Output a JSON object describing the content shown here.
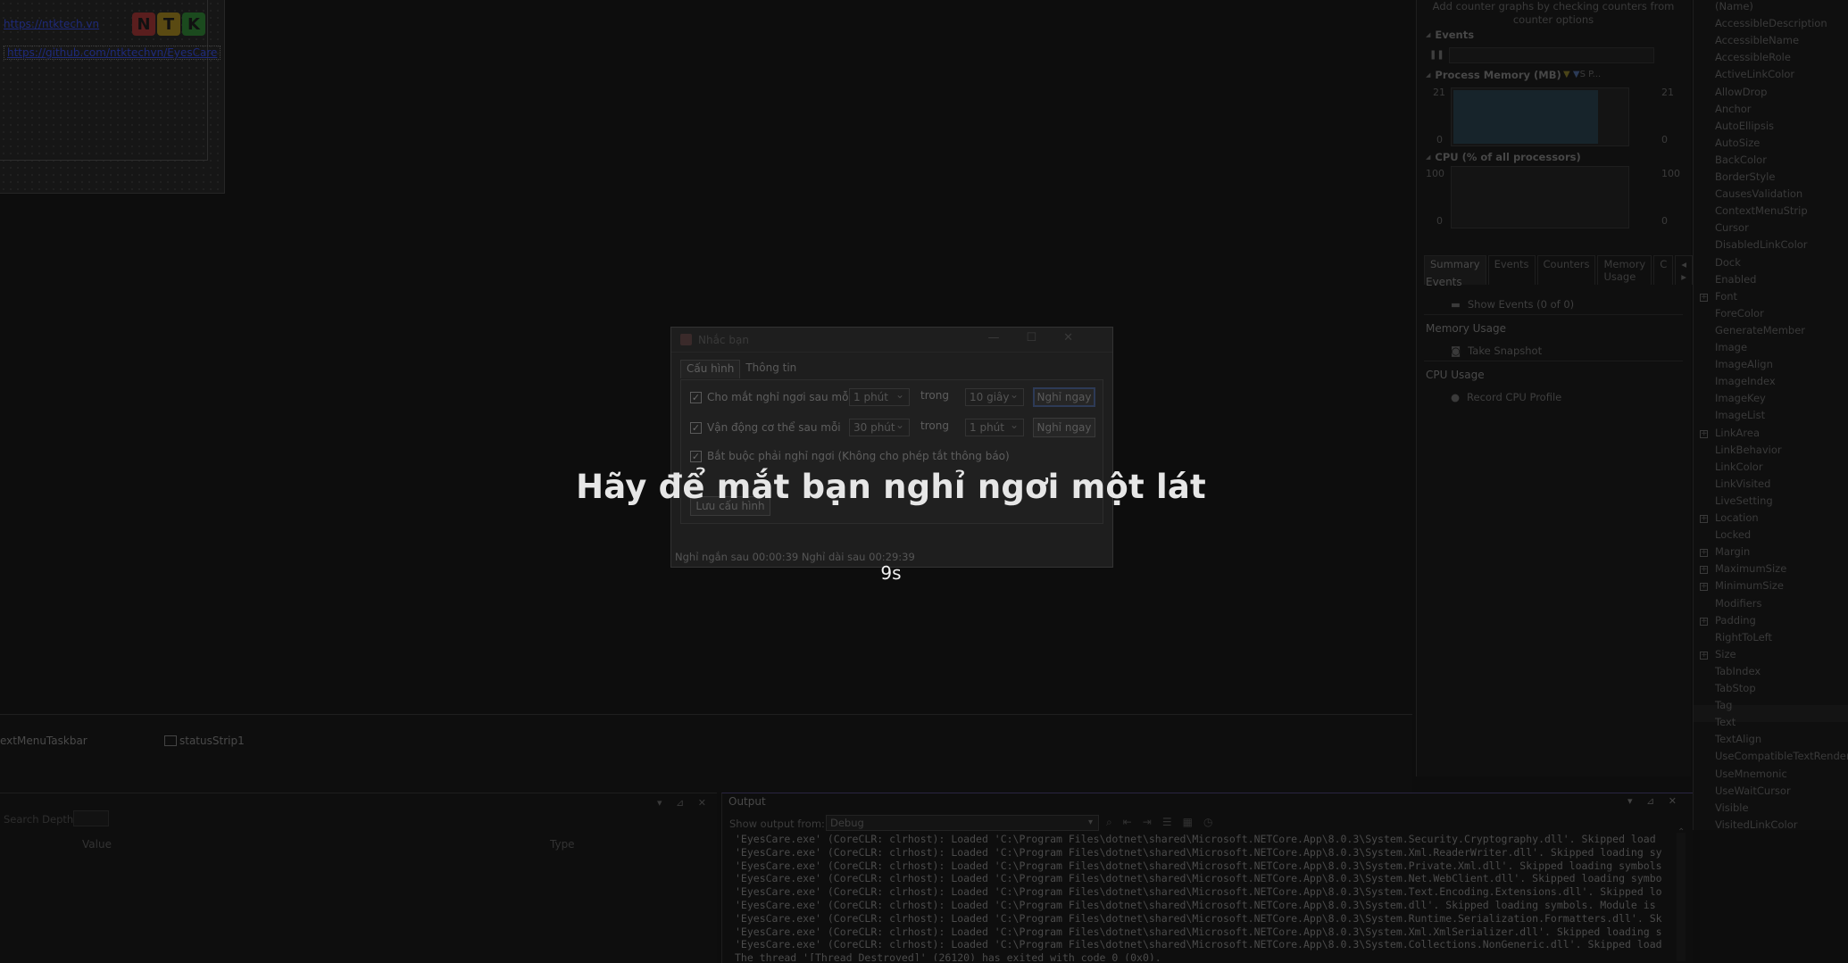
{
  "designer": {
    "links": [
      "https://ntktech.vn",
      "https://github.com/ntktechvn/EyesCare"
    ],
    "logo_letters": [
      "N",
      "T",
      "K"
    ]
  },
  "tray": {
    "items": [
      "extMenuTaskbar",
      "statusStrip1"
    ]
  },
  "diagnostics": {
    "hint": "Add counter graphs by checking counters from counter options",
    "events_label": "Events",
    "memory_label": "Process Memory (MB)",
    "memory_legend": "S  P...",
    "memory_max": "21",
    "memory_min": "0",
    "cpu_label": "CPU (% of all processors)",
    "cpu_max": "100",
    "cpu_min": "0",
    "tabs": [
      "Summary",
      "Events",
      "Counters",
      "Memory Usage",
      "C"
    ],
    "sections": [
      {
        "title": "Events",
        "item": "Show Events (0 of 0)"
      },
      {
        "title": "Memory Usage",
        "item": "Take Snapshot"
      },
      {
        "title": "CPU Usage",
        "item": "Record CPU Profile"
      }
    ]
  },
  "properties": [
    "(Name)",
    "AccessibleDescription",
    "AccessibleName",
    "AccessibleRole",
    "ActiveLinkColor",
    "AllowDrop",
    "Anchor",
    "AutoEllipsis",
    "AutoSize",
    "BackColor",
    "BorderStyle",
    "CausesValidation",
    "ContextMenuStrip",
    "Cursor",
    "DisabledLinkColor",
    "Dock",
    "Enabled",
    "Font",
    "ForeColor",
    "GenerateMember",
    "Image",
    "ImageAlign",
    "ImageIndex",
    "ImageKey",
    "ImageList",
    "LinkArea",
    "LinkBehavior",
    "LinkColor",
    "LinkVisited",
    "LiveSetting",
    "Location",
    "Locked",
    "Margin",
    "MaximumSize",
    "MinimumSize",
    "Modifiers",
    "Padding",
    "RightToLeft",
    "Size",
    "TabIndex",
    "TabStop",
    "Tag",
    "Text",
    "TextAlign",
    "UseCompatibleTextRendering",
    "UseMnemonic",
    "UseWaitCursor",
    "Visible",
    "VisitedLinkColor"
  ],
  "locals": {
    "search_label": "Search Depth:",
    "col_value": "Value",
    "col_type": "Type"
  },
  "output": {
    "title": "Output",
    "show_from_label": "Show output from:",
    "source": "Debug",
    "lines": [
      "'EyesCare.exe' (CoreCLR: clrhost): Loaded 'C:\\Program Files\\dotnet\\shared\\Microsoft.NETCore.App\\8.0.3\\System.Security.Cryptography.dll'. Skipped load",
      "'EyesCare.exe' (CoreCLR: clrhost): Loaded 'C:\\Program Files\\dotnet\\shared\\Microsoft.NETCore.App\\8.0.3\\System.Xml.ReaderWriter.dll'. Skipped loading sy",
      "'EyesCare.exe' (CoreCLR: clrhost): Loaded 'C:\\Program Files\\dotnet\\shared\\Microsoft.NETCore.App\\8.0.3\\System.Private.Xml.dll'. Skipped loading symbols",
      "'EyesCare.exe' (CoreCLR: clrhost): Loaded 'C:\\Program Files\\dotnet\\shared\\Microsoft.NETCore.App\\8.0.3\\System.Net.WebClient.dll'. Skipped loading symbo",
      "'EyesCare.exe' (CoreCLR: clrhost): Loaded 'C:\\Program Files\\dotnet\\shared\\Microsoft.NETCore.App\\8.0.3\\System.Text.Encoding.Extensions.dll'. Skipped lo",
      "'EyesCare.exe' (CoreCLR: clrhost): Loaded 'C:\\Program Files\\dotnet\\shared\\Microsoft.NETCore.App\\8.0.3\\System.dll'. Skipped loading symbols. Module is",
      "'EyesCare.exe' (CoreCLR: clrhost): Loaded 'C:\\Program Files\\dotnet\\shared\\Microsoft.NETCore.App\\8.0.3\\System.Runtime.Serialization.Formatters.dll'. Sk",
      "'EyesCare.exe' (CoreCLR: clrhost): Loaded 'C:\\Program Files\\dotnet\\shared\\Microsoft.NETCore.App\\8.0.3\\System.Xml.XmlSerializer.dll'. Skipped loading s",
      "'EyesCare.exe' (CoreCLR: clrhost): Loaded 'C:\\Program Files\\dotnet\\shared\\Microsoft.NETCore.App\\8.0.3\\System.Collections.NonGeneric.dll'. Skipped load",
      "The thread '[Thread Destroyed]' (26120) has exited with code 0 (0x0)."
    ]
  },
  "dialog": {
    "title": "Nhắc bạn",
    "tabs": [
      "Cấu hình",
      "Thông tin"
    ],
    "row1": {
      "label": "Cho mắt nghỉ ngơi sau mỗi",
      "interval": "1 phút",
      "during": "trong",
      "duration": "10 giây",
      "button": "Nghỉ ngay",
      "checked": true
    },
    "row2": {
      "label": "Vận động cơ thể sau mỗi",
      "interval": "30 phút",
      "during": "trong",
      "duration": "1 phút",
      "button": "Nghỉ ngay",
      "checked": true
    },
    "row3": {
      "label": "Bắt buộc phải nghỉ ngơi (Không cho phép tắt thông báo)",
      "checked": true
    },
    "save_button": "Lưu cấu hình",
    "status": "Nghỉ ngắn sau 00:00:39  Nghỉ dài sau 00:29:39"
  },
  "overlay": {
    "message": "Hãy để mắt bạn nghỉ ngơi một lát",
    "countdown": "9s"
  }
}
